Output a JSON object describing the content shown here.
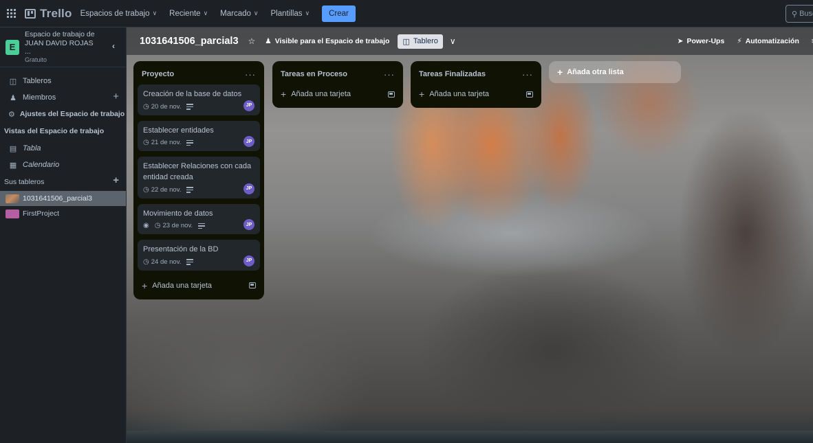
{
  "topnav": {
    "logo": "Trello",
    "items": [
      {
        "label": "Espacios de trabajo"
      },
      {
        "label": "Reciente"
      },
      {
        "label": "Marcado"
      },
      {
        "label": "Plantillas"
      }
    ],
    "create_label": "Crear",
    "search_placeholder": "Busc"
  },
  "sidebar": {
    "workspace_name": "Espacio de trabajo de JUAN DAVID ROJAS ...",
    "workspace_initial": "E",
    "workspace_plan": "Gratuito",
    "items": [
      {
        "label": "Tableros"
      },
      {
        "label": "Miembros"
      },
      {
        "label": "Ajustes del Espacio de trabajo"
      }
    ],
    "views_heading": "Vistas del Espacio de trabajo",
    "views": [
      {
        "label": "Tabla"
      },
      {
        "label": "Calendario"
      }
    ],
    "boards_heading": "Sus tableros",
    "boards": [
      {
        "label": "1031641506_parcial3"
      },
      {
        "label": "FirstProject"
      }
    ]
  },
  "board": {
    "title": "1031641506_parcial3",
    "visibility": "Visible para el Espacio de trabajo",
    "view": "Tablero",
    "powerups": "Power-Ups",
    "automation": "Automatización",
    "add_list": "Añada otra lista"
  },
  "lists": [
    {
      "title": "Proyecto",
      "cards": [
        {
          "title": "Creación de la base de datos",
          "date": "20 de nov.",
          "member": "JP"
        },
        {
          "title": "Establecer entidades",
          "date": "21 de nov.",
          "member": "JP"
        },
        {
          "title": "Establecer Relaciones con cada entidad creada",
          "date": "22 de nov.",
          "member": "JP"
        },
        {
          "title": "Movimiento de datos",
          "date": "23 de nov.",
          "member": "JP"
        },
        {
          "title": "Presentación de la BD",
          "date": "24 de nov.",
          "member": "JP"
        }
      ],
      "add_card": "Añada una tarjeta"
    },
    {
      "title": "Tareas en Proceso",
      "cards": [],
      "add_card": "Añada una tarjeta"
    },
    {
      "title": "Tareas Finalizadas",
      "cards": [],
      "add_card": "Añada una tarjeta"
    }
  ]
}
